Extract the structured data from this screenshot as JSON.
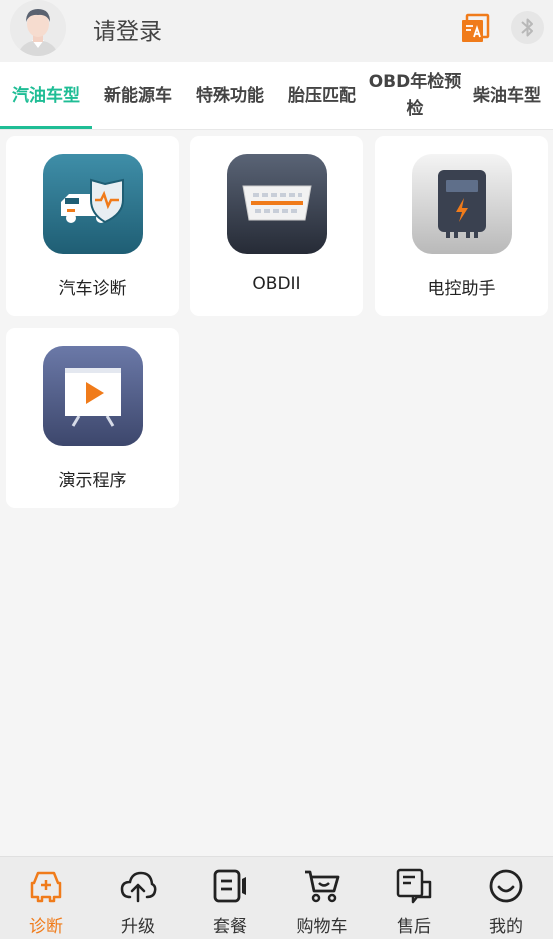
{
  "header": {
    "login_text": "请登录"
  },
  "tabs": [
    {
      "label": "汽油车型",
      "active": true
    },
    {
      "label": "新能源车",
      "active": false
    },
    {
      "label": "特殊功能",
      "active": false
    },
    {
      "label": "胎压匹配",
      "active": false
    },
    {
      "label": "OBD年检预检",
      "active": false
    },
    {
      "label": "柴油车型",
      "active": false
    }
  ],
  "cards": [
    {
      "label": "汽车诊断",
      "icon": "car-diagnosis-icon"
    },
    {
      "label": "OBDII",
      "icon": "obd-connector-icon"
    },
    {
      "label": "电控助手",
      "icon": "ecu-assistant-icon"
    },
    {
      "label": "演示程序",
      "icon": "demo-video-icon"
    }
  ],
  "nav": [
    {
      "label": "诊断",
      "icon": "diagnosis-icon",
      "active": true
    },
    {
      "label": "升级",
      "icon": "cloud-upload-icon",
      "active": false
    },
    {
      "label": "套餐",
      "icon": "package-icon",
      "active": false
    },
    {
      "label": "购物车",
      "icon": "cart-icon",
      "active": false
    },
    {
      "label": "售后",
      "icon": "after-sales-icon",
      "active": false
    },
    {
      "label": "我的",
      "icon": "smile-icon",
      "active": false
    }
  ],
  "colors": {
    "accent": "#1fbd95",
    "nav_active": "#f07b1a",
    "header_icon": "#f07b1a"
  }
}
